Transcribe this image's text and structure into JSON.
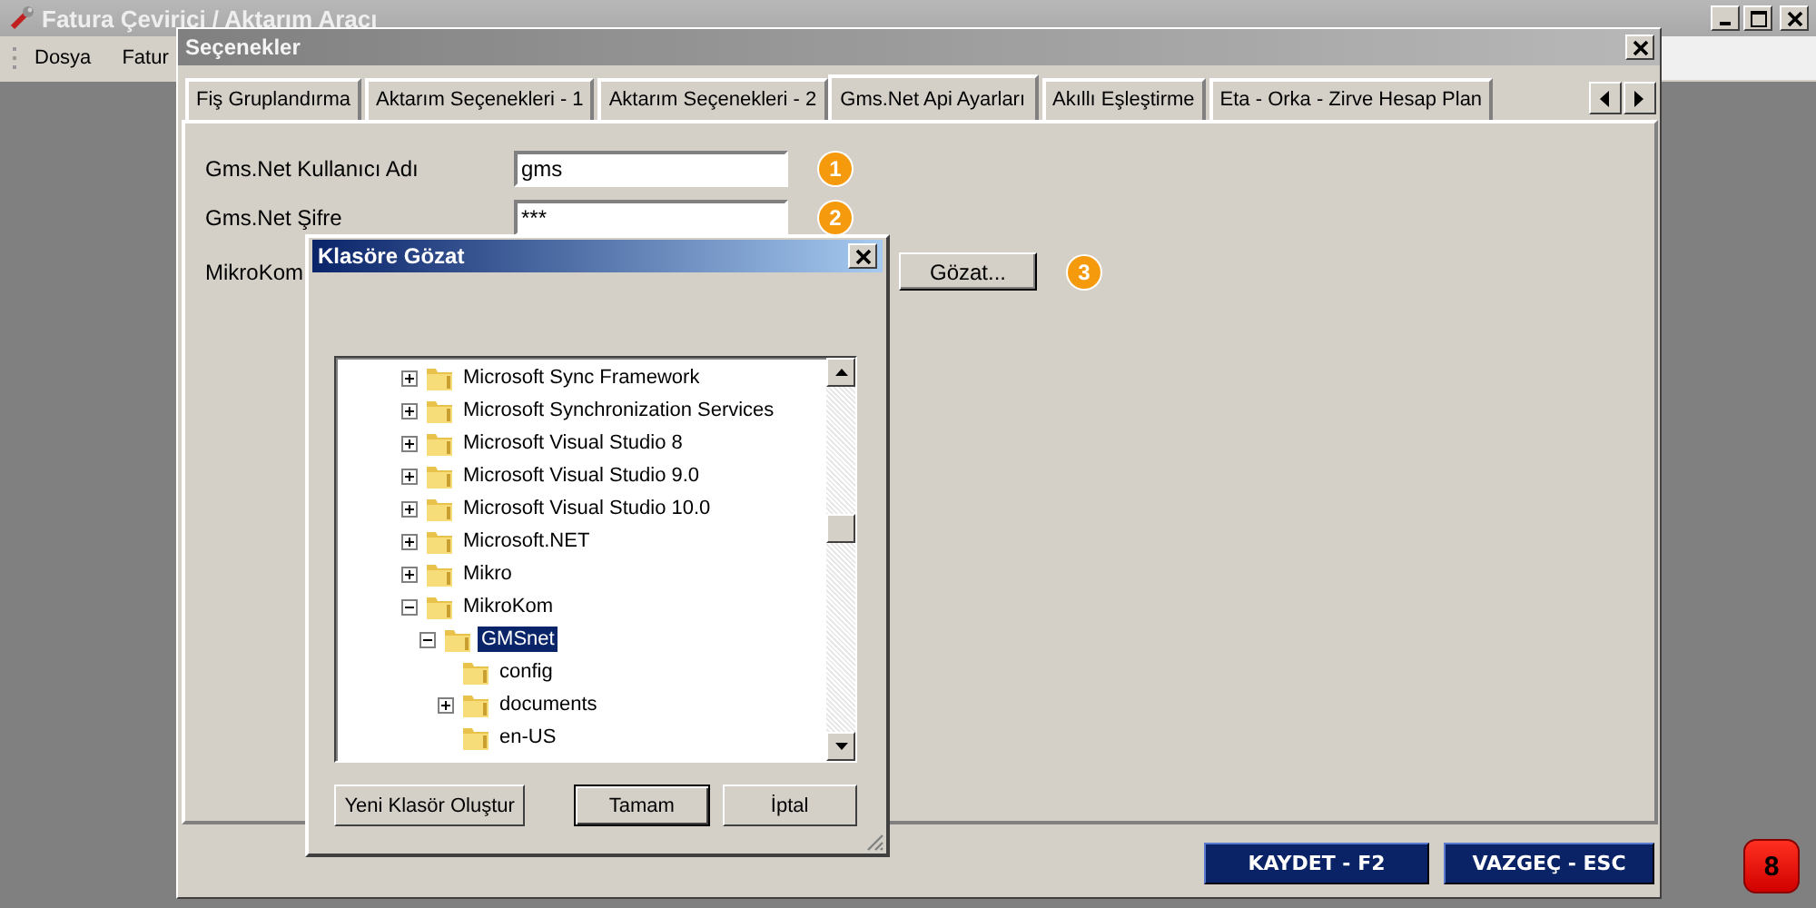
{
  "main_window": {
    "title": "Fatura Çevirici / Aktarım Aracı",
    "menu": [
      "Dosya",
      "Fatur"
    ]
  },
  "options_dialog": {
    "title": "Seçenekler",
    "tabs": [
      {
        "label": "Fiş Gruplandırma",
        "selected": false
      },
      {
        "label": "Aktarım Seçenekleri - 1",
        "selected": false
      },
      {
        "label": "Aktarım Seçenekleri - 2",
        "selected": false
      },
      {
        "label": "Gms.Net Api Ayarları",
        "selected": true
      },
      {
        "label": "Akıllı Eşleştirme",
        "selected": false
      },
      {
        "label": "Eta - Orka - Zirve Hesap Plan",
        "selected": false
      }
    ],
    "fields": [
      {
        "label": "Gms.Net Kullanıcı Adı",
        "value": "gms",
        "badge": "1"
      },
      {
        "label": "Gms.Net Şifre",
        "value": "***",
        "badge": "2"
      }
    ],
    "folder_row": {
      "label": "MikroKom",
      "button": "Gözat...",
      "badge": "3"
    },
    "buttons": [
      "KAYDET - F2",
      "VAZGEÇ - ESC"
    ]
  },
  "browse_dialog": {
    "title": "Klasöre Gözat",
    "tree": [
      {
        "label": "Microsoft Sync Framework",
        "expanded": false,
        "selected": false
      },
      {
        "label": "Microsoft Synchronization Services",
        "expanded": false,
        "selected": false
      },
      {
        "label": "Microsoft Visual Studio 8",
        "expanded": false,
        "selected": false
      },
      {
        "label": "Microsoft Visual Studio 9.0",
        "expanded": false,
        "selected": false
      },
      {
        "label": "Microsoft Visual Studio 10.0",
        "expanded": false,
        "selected": false
      },
      {
        "label": "Microsoft.NET",
        "expanded": false,
        "selected": false
      },
      {
        "label": "Mikro",
        "expanded": false,
        "selected": false
      },
      {
        "label": "MikroKom",
        "expanded": true,
        "selected": false,
        "children": [
          {
            "label": "GMSnet",
            "expanded": true,
            "selected": true,
            "children": [
              {
                "label": "config",
                "selected": false
              },
              {
                "label": "documents",
                "expanded": false,
                "selected": false
              },
              {
                "label": "en-US",
                "selected": false
              }
            ]
          }
        ]
      }
    ],
    "buttons": [
      "Yeni Klasör Oluştur",
      "Tamam",
      "İptal"
    ]
  },
  "corner_badge": "8"
}
